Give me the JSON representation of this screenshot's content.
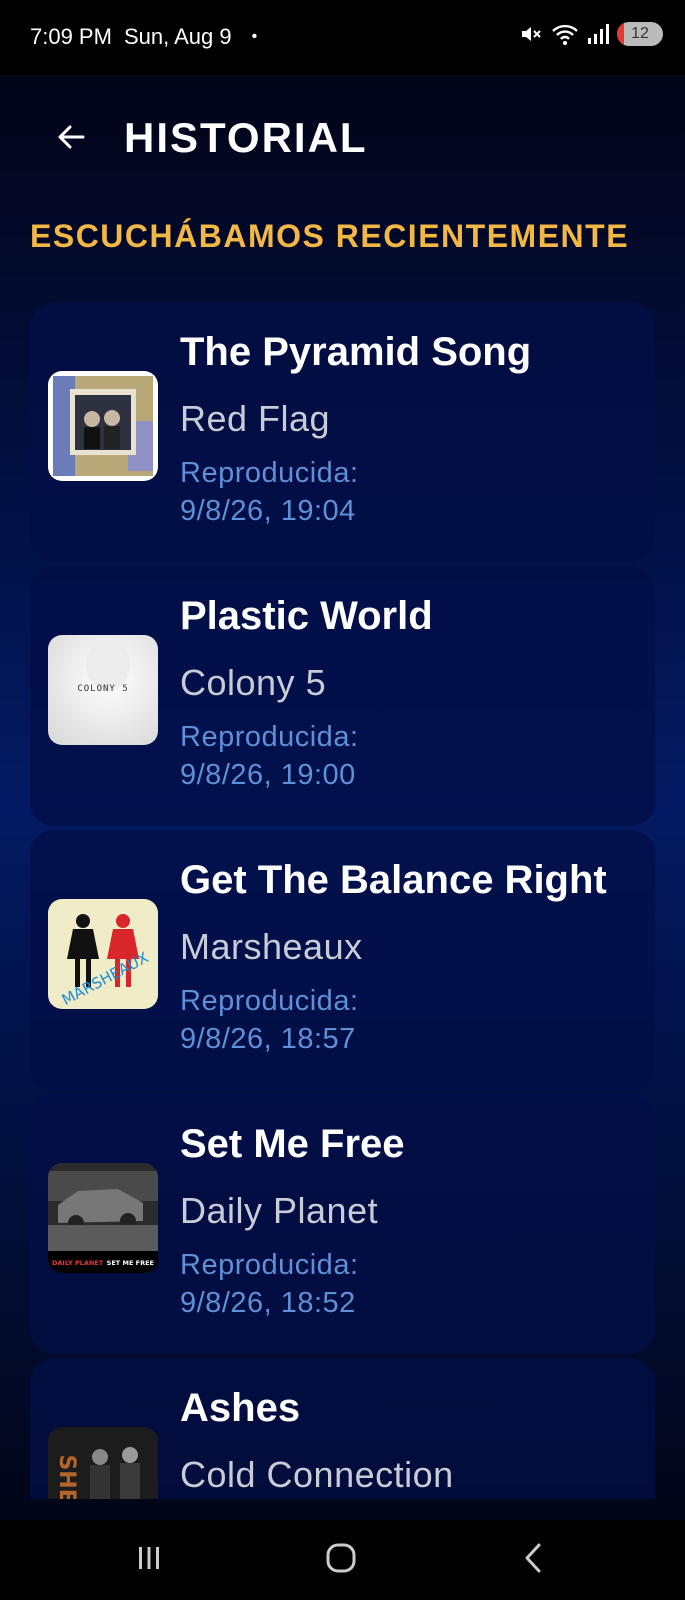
{
  "status_bar": {
    "time": "7:09 PM",
    "date": "Sun, Aug 9",
    "dot": "•",
    "battery": "12",
    "icons": [
      "mute-icon",
      "wifi-icon",
      "signal-icon",
      "battery-icon"
    ]
  },
  "header": {
    "title": "HISTORIAL",
    "back_icon": "arrow-left-icon"
  },
  "section_title": "ESCUCHÁBAMOS RECIENTEMENTE",
  "history": [
    {
      "title": "The Pyramid Song",
      "artist": "Red Flag",
      "played_label": "Reproducida:",
      "played_time": "9/8/26, 19:04"
    },
    {
      "title": "Plastic World",
      "artist": "Colony 5",
      "played_label": "Reproducida:",
      "played_time": "9/8/26, 19:00",
      "cover_text": "COLONY 5"
    },
    {
      "title": "Get The Balance Right",
      "artist": "Marsheaux",
      "played_label": "Reproducida:",
      "played_time": "9/8/26, 18:57",
      "cover_text": "MARSHEAUX"
    },
    {
      "title": "Set Me Free",
      "artist": "Daily Planet",
      "played_label": "Reproducida:",
      "played_time": "9/8/26, 18:52",
      "cover_text_left": "DAILY PLANET",
      "cover_text_right": "SET ME FREE"
    },
    {
      "title": "Ashes",
      "artist": "Cold Connection",
      "played_label": "",
      "played_time": "",
      "cover_text": "SHES"
    }
  ],
  "nav_bar": {
    "icons": [
      "recents-icon",
      "home-icon",
      "back-icon"
    ]
  },
  "colors": {
    "accent": "#f3b745",
    "played": "#5f8fd6",
    "card": "#020e46"
  }
}
